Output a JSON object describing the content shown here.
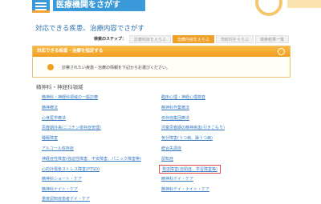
{
  "header": {
    "brand": "医療機関をさがす"
  },
  "page_title": "対応できる疾患、治療内容でさがす",
  "steps": {
    "label": "検索のステップ：",
    "items": [
      "診療科目をえらぶ",
      "治療内容をえらぶ",
      "市町村をえらぶ",
      "検索結果一覧"
    ]
  },
  "section": {
    "heading": "対応できる疾患・治療を指定する",
    "instruction": "診察されたい疾患・治療の情報を下記からお選びください。"
  },
  "category": "精神科・神経科領域",
  "links_left": [
    "精神科・神経科領域の一般診療",
    "精神療法",
    "心身医学療法",
    "思春期外来(ニコチン依存症管理)",
    "睡眠障害",
    "アルコール依存症",
    "神経症性障害(強迫性障害、不安障害、パニック障害等)",
    "心的外傷後ストレス障害(PTSD)",
    "精神科ショート・ケア",
    "精神科ナイト・ケア",
    "重度認知症患者デイ・ケア"
  ],
  "links_right": [
    "臨床心理・神経心理検査",
    "精神科作業療法",
    "依存症集団療法",
    "児童思春期の精神疾患(引きこもり)",
    "気分障害(うつ病、躁うつ病)",
    "統合失調症",
    "認知症",
    "発達障害(自閉症、学習障害等)",
    "精神科デイ・ケア",
    "精神科デイ・ナイト・ケア"
  ]
}
